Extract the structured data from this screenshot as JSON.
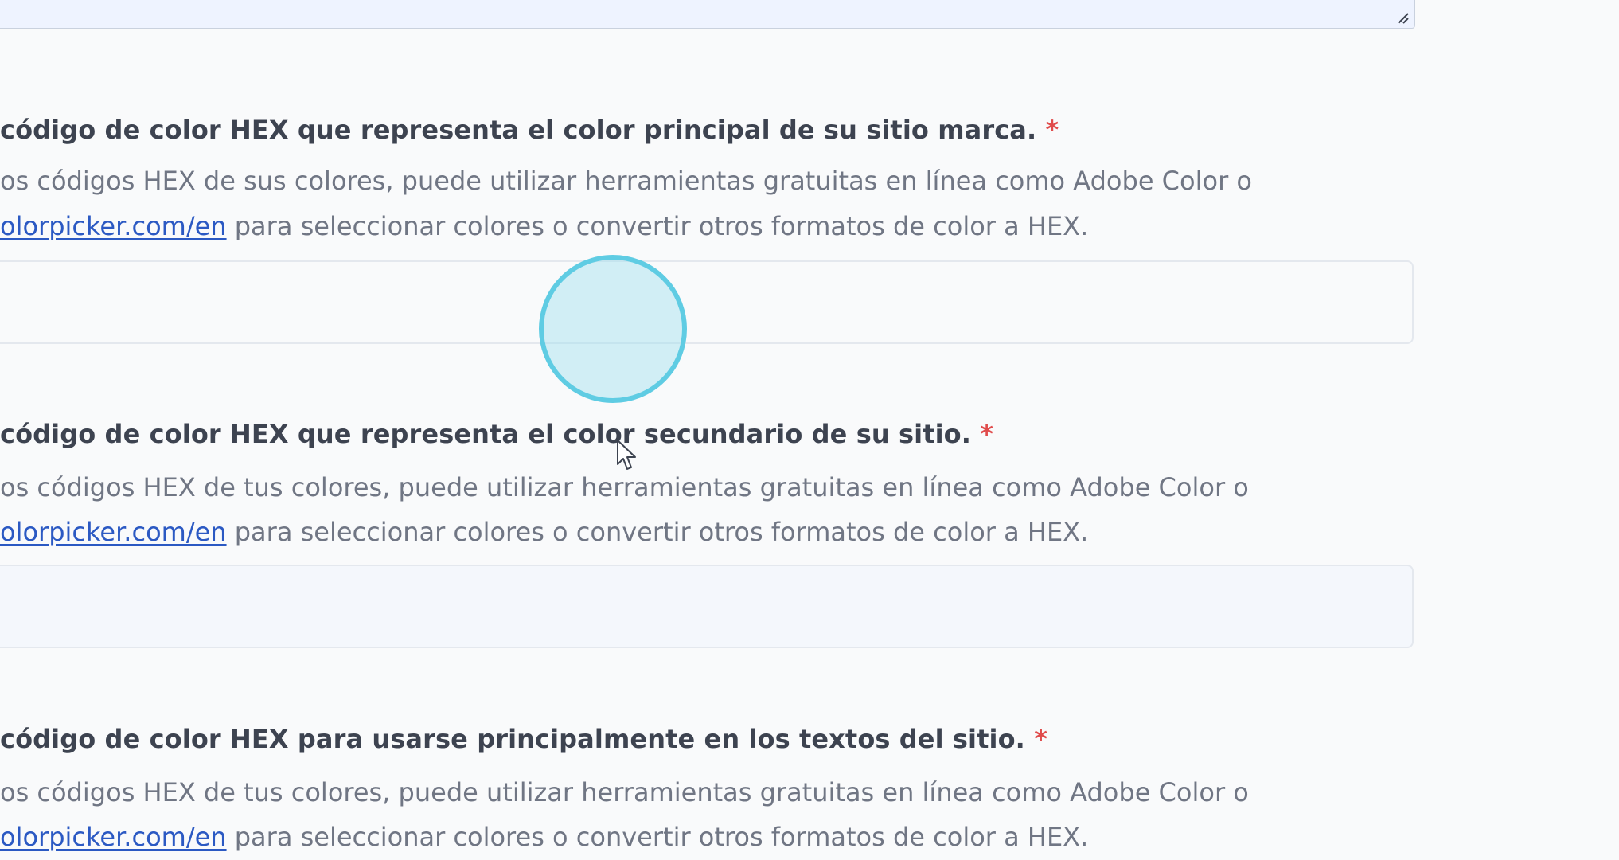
{
  "top_textarea": {
    "resize_icon": "resize-grip-icon"
  },
  "fields": [
    {
      "question": "código de color HEX que representa el color principal de su sitio marca.",
      "required_mark": "*",
      "helper_line1": "os códigos HEX de sus colores, puede utilizar herramientas gratuitas en línea como Adobe Color o",
      "helper_link": "olorpicker.com/en",
      "helper_line2_rest": " para seleccionar colores o convertir otros formatos de color a HEX.",
      "input_value": ""
    },
    {
      "question": "código de color HEX que representa el color secundario de su sitio.",
      "required_mark": "*",
      "helper_line1": "os códigos HEX de tus colores, puede utilizar herramientas gratuitas en línea como Adobe Color o",
      "helper_link": "olorpicker.com/en",
      "helper_line2_rest": " para seleccionar colores o convertir otros formatos de color a HEX.",
      "input_value": ""
    },
    {
      "question": "código de color HEX para usarse principalmente en los textos del sitio.",
      "required_mark": "*",
      "helper_line1": "os códigos HEX de tus colores, puede utilizar herramientas gratuitas en línea como Adobe Color o",
      "helper_link": "olorpicker.com/en",
      "helper_line2_rest": " para seleccionar colores o convertir otros formatos de color a HEX."
    }
  ],
  "colors": {
    "required": "#e04b4b",
    "link": "#2b59c3",
    "click_ring": "#5fcce3"
  },
  "overlay": {
    "click_indicator_icon": "click-indicator-icon",
    "cursor_icon": "mouse-pointer-icon"
  }
}
